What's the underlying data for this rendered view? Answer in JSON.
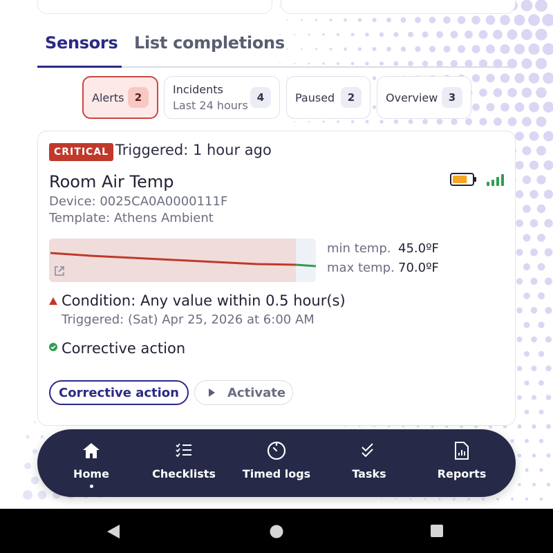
{
  "tabs": [
    {
      "label": "Sensors",
      "active": true
    },
    {
      "label": "List completions",
      "active": false
    }
  ],
  "filters": [
    {
      "label": "Alerts",
      "count": "2",
      "active": true
    },
    {
      "label": "Incidents",
      "sublabel": "Last 24 hours",
      "count": "4",
      "active": false
    },
    {
      "label": "Paused",
      "count": "2",
      "active": false
    },
    {
      "label": "Overview",
      "count": "3",
      "active": false
    }
  ],
  "alert": {
    "severity": "CRITICAL",
    "triggered_ago": "Triggered: 1 hour ago",
    "sensor_name": "Room Air Temp",
    "device": "Device: 0025CA0A0000111F",
    "template": "Template: Athens Ambient",
    "min_label": "min temp.",
    "min_value": "45.0ºF",
    "max_label": "max temp.",
    "max_value": "70.0ºF",
    "condition": "Condition: Any value within 0.5 hour(s)",
    "condition_triggered": "Triggered: (Sat) Apr 25, 2026 at 6:00 AM",
    "corrective_title": "Corrective action",
    "buttons": {
      "corrective": "Corrective action",
      "activate": "Activate"
    },
    "battery_level": 0.75,
    "signal_bars": 4
  },
  "colors": {
    "accent": "#2b2a85",
    "critical": "#c0392b",
    "ok": "#2e9e4f",
    "battery": "#f5a623",
    "nav_bg": "#262a48"
  },
  "nav": [
    {
      "label": "Home",
      "icon": "home-icon",
      "active": true
    },
    {
      "label": "Checklists",
      "icon": "checklist-icon",
      "active": false
    },
    {
      "label": "Timed logs",
      "icon": "timer-icon",
      "active": false
    },
    {
      "label": "Tasks",
      "icon": "double-check-icon",
      "active": false
    },
    {
      "label": "Reports",
      "icon": "report-icon",
      "active": false
    }
  ]
}
